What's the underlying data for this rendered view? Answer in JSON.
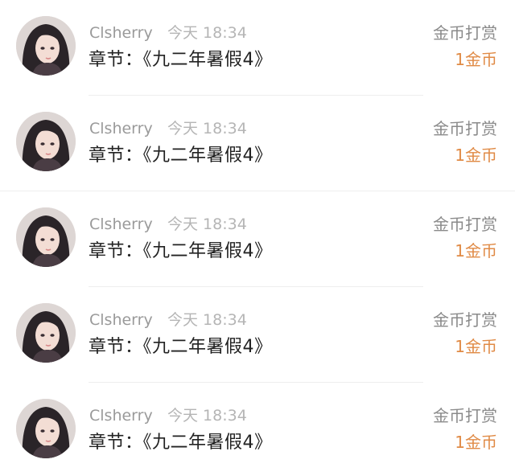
{
  "colors": {
    "username": "#9a9a9a",
    "time": "#b5b5b5",
    "chapter": "#222222",
    "tip_type": "#8a8a8a",
    "tip_amount": "#e08a45"
  },
  "records": [
    {
      "avatar_icon": "anime-girl-avatar",
      "username": "Clsherry",
      "time": "今天 18:34",
      "chapter": "章节：《九二年暑假4》",
      "tip_type": "金币打赏",
      "amount": "1金币"
    },
    {
      "avatar_icon": "anime-girl-avatar",
      "username": "Clsherry",
      "time": "今天 18:34",
      "chapter": "章节：《九二年暑假4》",
      "tip_type": "金币打赏",
      "amount": "1金币"
    },
    {
      "avatar_icon": "anime-girl-avatar",
      "username": "Clsherry",
      "time": "今天 18:34",
      "chapter": "章节：《九二年暑假4》",
      "tip_type": "金币打赏",
      "amount": "1金币"
    },
    {
      "avatar_icon": "anime-girl-avatar",
      "username": "Clsherry",
      "time": "今天 18:34",
      "chapter": "章节：《九二年暑假4》",
      "tip_type": "金币打赏",
      "amount": "1金币"
    },
    {
      "avatar_icon": "anime-girl-avatar",
      "username": "Clsherry",
      "time": "今天 18:34",
      "chapter": "章节：《九二年暑假4》",
      "tip_type": "金币打赏",
      "amount": "1金币"
    }
  ]
}
